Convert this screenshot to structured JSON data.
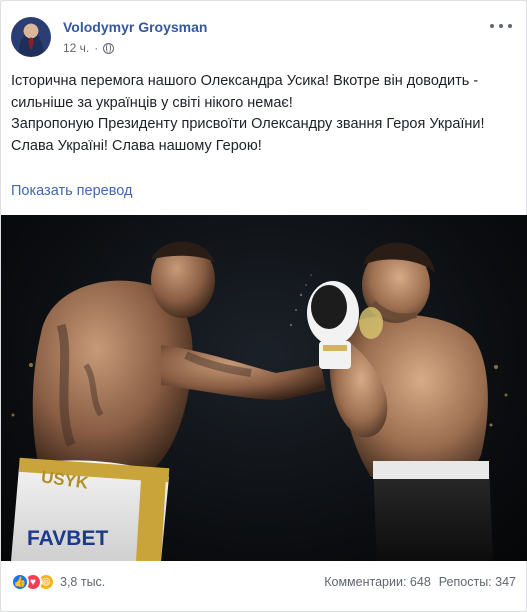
{
  "post": {
    "author": "Volodymyr Groysman",
    "time": "12 ч.",
    "text_lines": [
      "Історична перемога нашого Олександра Усика! Вкотре він доводить - сильніше за українців у світі нікого немає!",
      "Запропоную Президенту присвоїти Олександру звання Героя України!",
      "Слава Україні! Слава нашому Герою!"
    ],
    "translate_label": "Показать перевод"
  },
  "photo": {
    "trunks_left_text": "USYK",
    "sponsor_text": "FAVBET"
  },
  "footer": {
    "reactions": [
      "like-icon",
      "love-icon",
      "haha-icon"
    ],
    "reaction_count": "3,8 тыс.",
    "comments": "Комментарии: 648",
    "shares": "Репосты: 347"
  },
  "colors": {
    "author": "#365899",
    "link": "#4267b2",
    "meta": "#616770"
  }
}
